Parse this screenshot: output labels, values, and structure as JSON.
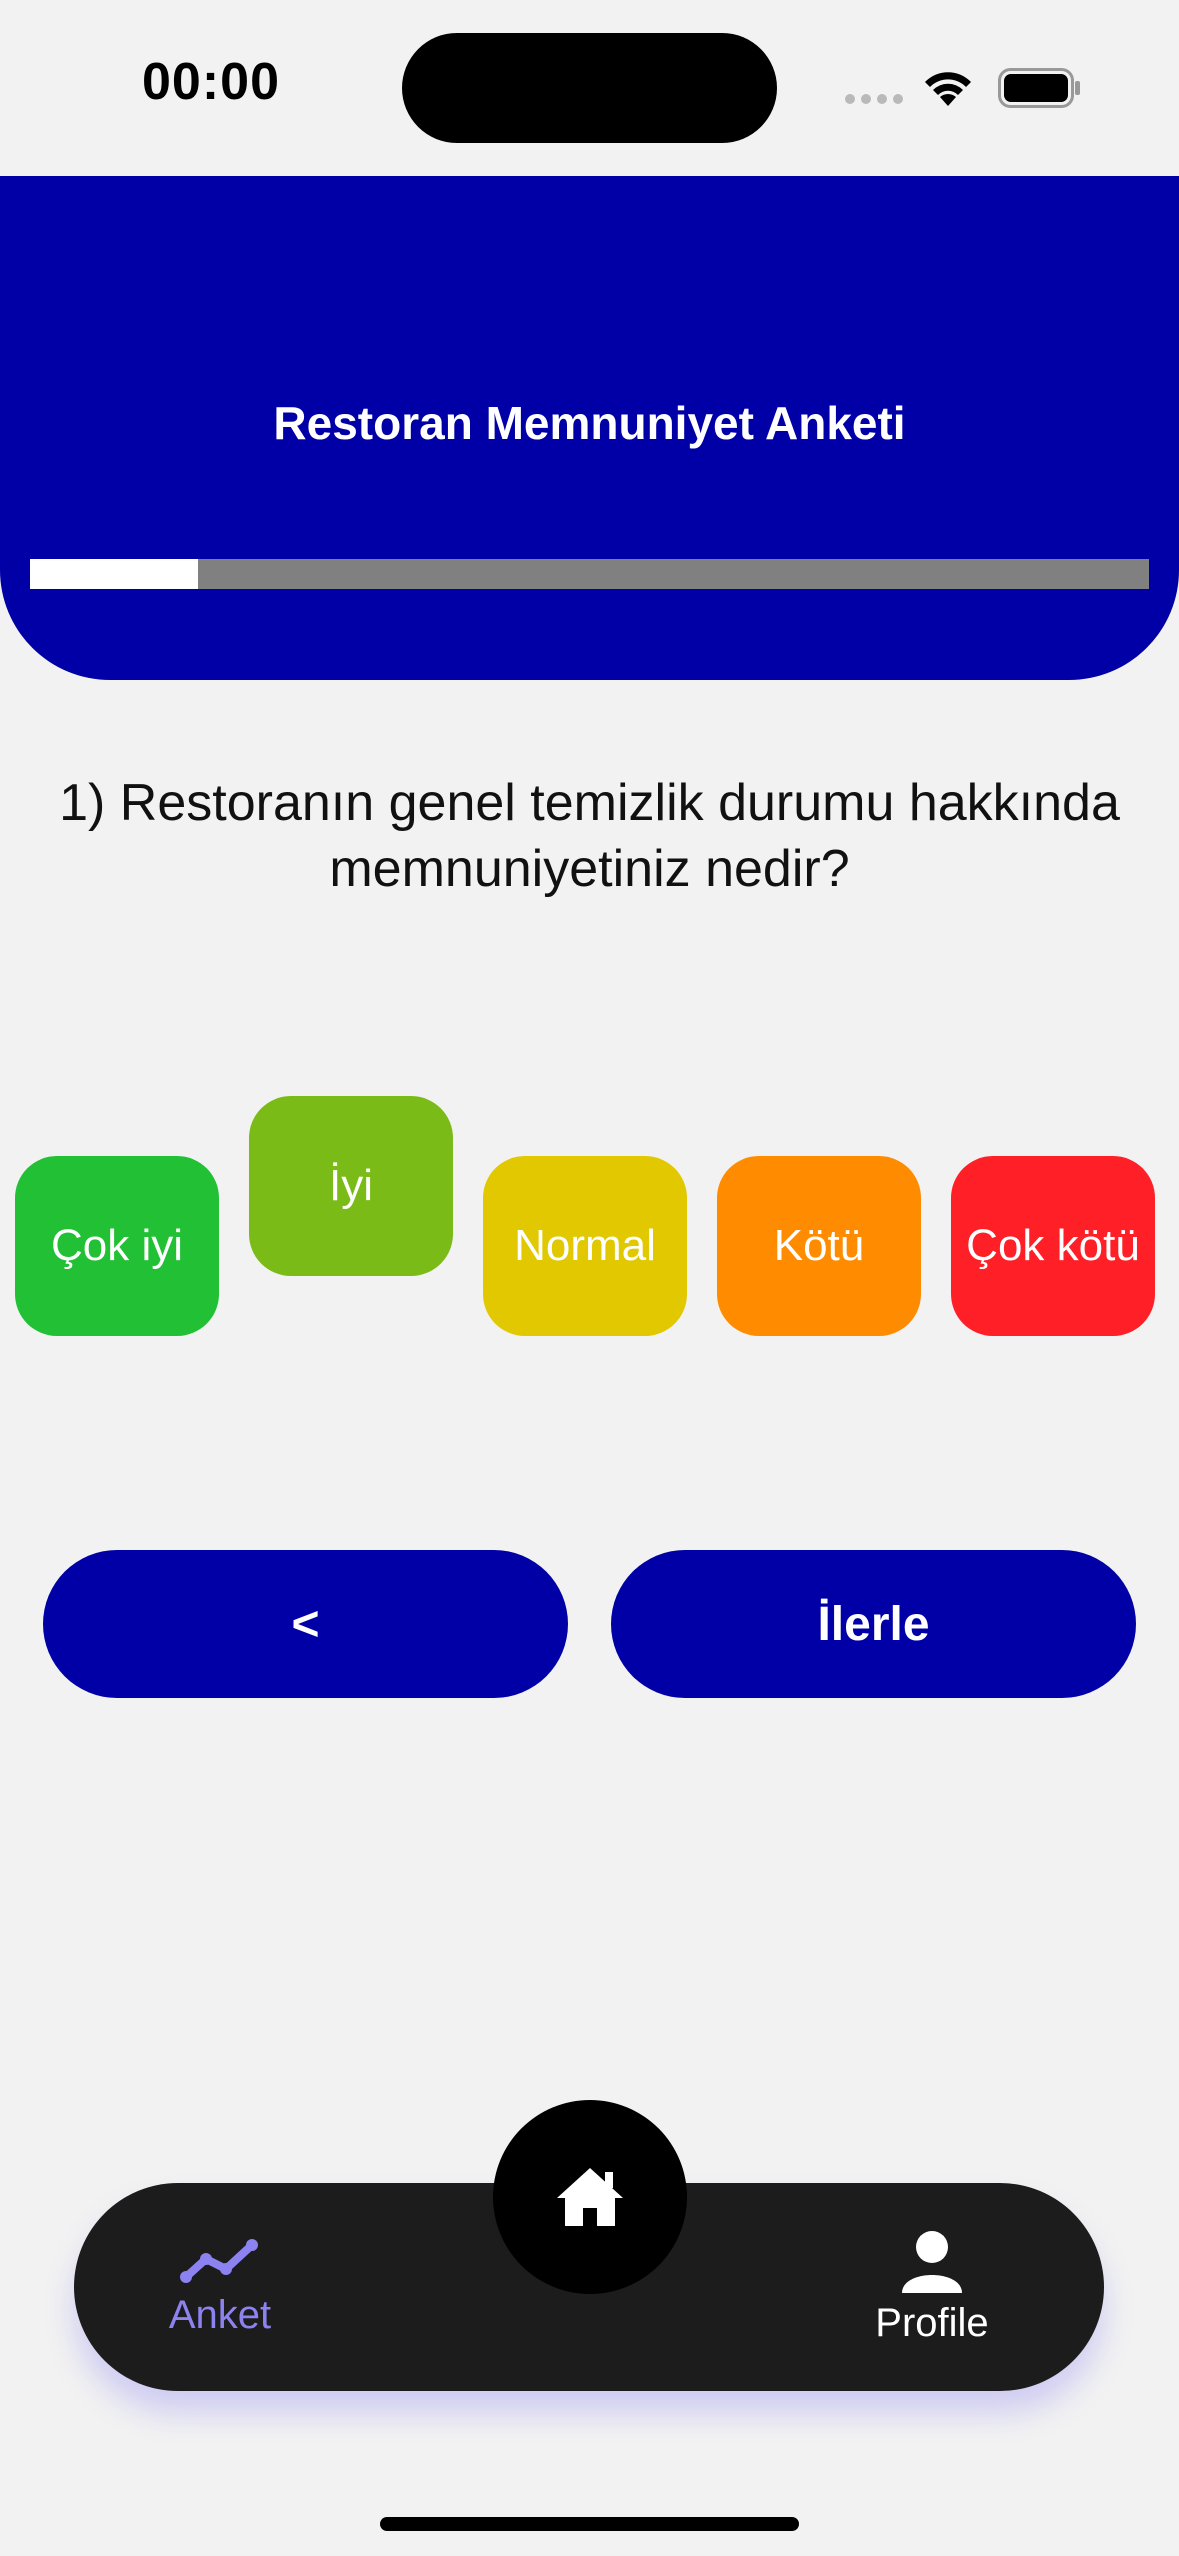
{
  "status_bar": {
    "time": "00:00"
  },
  "header": {
    "title": "Restoran Memnuniyet Anketi",
    "progress": 0.15,
    "color": "#0000a6"
  },
  "question": {
    "text": "1) Restoranın genel temizlik durumu hakkında memnuniyetiniz nedir?"
  },
  "ratings": [
    {
      "label": "Çok iyi",
      "color": "#22c034",
      "selected": false
    },
    {
      "label": "İyi",
      "color": "#7abb17",
      "selected": true
    },
    {
      "label": "Normal",
      "color": "#e1c800",
      "selected": false
    },
    {
      "label": "Kötü",
      "color": "#ff8c00",
      "selected": false
    },
    {
      "label": "Çok kötü",
      "color": "#ff1f27",
      "selected": false
    }
  ],
  "navigation": {
    "back_label": "<",
    "next_label": "İlerle"
  },
  "tab_bar": {
    "items": [
      {
        "label": "Anket",
        "icon": "chart-line-icon",
        "active": true,
        "color": "#8c82f0"
      },
      {
        "label": "Profile",
        "icon": "person-icon",
        "active": false,
        "color": "#ffffff"
      }
    ],
    "center_icon": "home-icon"
  }
}
